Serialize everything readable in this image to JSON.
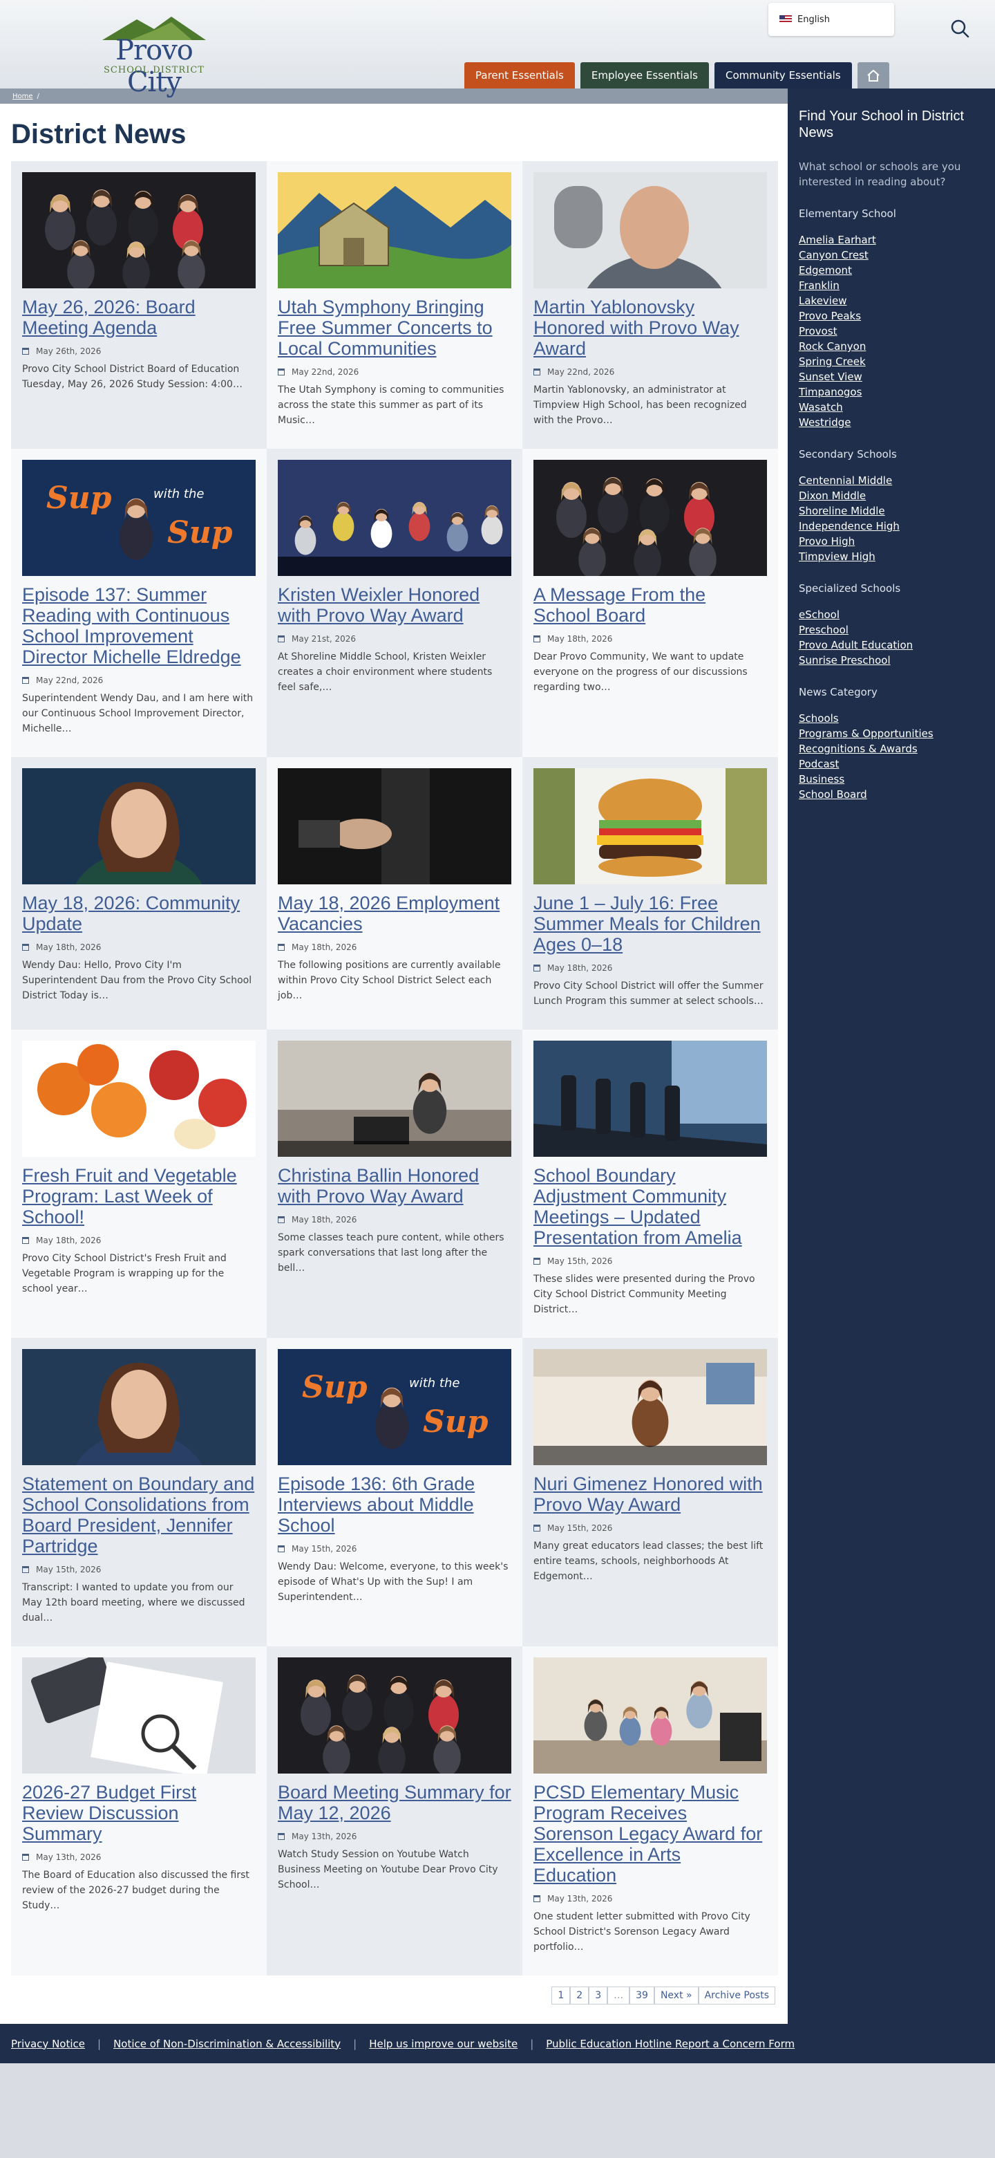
{
  "header": {
    "logo_name": "Provo City",
    "logo_sub": "SCHOOL DISTRICT",
    "language": "English",
    "nav": [
      "Parent Essentials",
      "Employee Essentials",
      "Community Essentials"
    ],
    "colors": {
      "parent": "#c4511d",
      "employee": "#2f4a3a",
      "community": "#1d2b4a",
      "sidebar": "#1f2f4b",
      "link": "#3f5d94"
    }
  },
  "breadcrumb": "Home",
  "page_title": "District News",
  "posts": [
    {
      "title": "May 26, 2026: Board Meeting Agenda",
      "date": "May 26th, 2026",
      "excerpt": "Provo City School District Board of Education Tuesday, May 26, 2026 Study Session: 4:00…",
      "image": "group-photo"
    },
    {
      "title": "Utah Symphony Bringing Free Summer Concerts to Local Communities",
      "date": "May 22nd, 2026",
      "excerpt": "The Utah Symphony is coming to communities across the state this summer as part of its Music…",
      "image": "barn-illustration"
    },
    {
      "title": "Martin Yablonovsky Honored with Provo Way Award",
      "date": "May 22nd, 2026",
      "excerpt": "Martin Yablonovsky, an administrator at Timpview High School, has been recognized with the Provo…",
      "image": "portrait-man"
    },
    {
      "title": "Episode 137: Summer Reading with Continuous School Improvement Director Michelle Eldredge",
      "date": "May 22nd, 2026",
      "excerpt": "Superintendent Wendy Dau, and I am here with our Continuous School Improvement Director, Michelle…",
      "image": "sup-podcast"
    },
    {
      "title": "Kristen Weixler Honored with Provo Way Award",
      "date": "May 21st, 2026",
      "excerpt": "At Shoreline Middle School, Kristen Weixler creates a choir environment where students feel safe,…",
      "image": "choir-classroom"
    },
    {
      "title": "A Message From the School Board",
      "date": "May 18th, 2026",
      "excerpt": "Dear Provo Community, We want to update everyone on the progress of our discussions regarding two…",
      "image": "group-photo"
    },
    {
      "title": "May 18, 2026: Community Update",
      "date": "May 18th, 2026",
      "excerpt": "Wendy Dau: Hello, Provo City I'm Superintendent Dau from the Provo City School District Today is…",
      "image": "portrait-woman"
    },
    {
      "title": "May 18, 2026 Employment Vacancies",
      "date": "May 18th, 2026",
      "excerpt": "The following positions are currently available within Provo City School District Select each job…",
      "image": "handshake"
    },
    {
      "title": "June 1 – July 16: Free Summer Meals for Children Ages 0–18",
      "date": "May 18th, 2026",
      "excerpt": "Provo City School District will offer the Summer Lunch Program this summer at select schools…",
      "image": "burger"
    },
    {
      "title": "Fresh Fruit and Vegetable Program: Last Week of School!",
      "date": "May 18th, 2026",
      "excerpt": "Provo City School District's Fresh Fruit and Vegetable Program is wrapping up for the school year…",
      "image": "fruit"
    },
    {
      "title": "Christina Ballin Honored with Provo Way Award",
      "date": "May 18th, 2026",
      "excerpt": "Some classes teach pure content, while others spark conversations that last long after the bell…",
      "image": "teacher-classroom"
    },
    {
      "title": "School Boundary Adjustment Community Meetings – Updated Presentation from Amelia",
      "date": "May 15th, 2026",
      "excerpt": "These slides were presented during the Provo City School District Community Meeting District…",
      "image": "boardroom"
    },
    {
      "title": "Statement on Boundary and School Consolidations from Board President, Jennifer Partridge",
      "date": "May 15th, 2026",
      "excerpt": "Transcript:  I wanted to update you from our May 12th board meeting, where we discussed dual…",
      "image": "portrait-woman-2"
    },
    {
      "title": "Episode 136: 6th Grade Interviews about Middle School",
      "date": "May 15th, 2026",
      "excerpt": "Wendy Dau: Welcome, everyone, to this week's episode of What's Up with the Sup! I am Superintendent…",
      "image": "sup-podcast"
    },
    {
      "title": "Nuri Gimenez Honored with Provo Way Award",
      "date": "May 15th, 2026",
      "excerpt": "Many great educators lead classes; the best lift entire teams, schools, neighborhoods At Edgemont…",
      "image": "teacher-woman"
    },
    {
      "title": "2026-27 Budget First Review Discussion Summary",
      "date": "May 13th, 2026",
      "excerpt": "The Board of Education also discussed the first review of the 2026-27 budget during the Study…",
      "image": "budget-papers"
    },
    {
      "title": "Board Meeting Summary for May 12, 2026",
      "date": "May 13th, 2026",
      "excerpt": "Watch Study Session on Youtube Watch Business Meeting on Youtube Dear Provo City School…",
      "image": "group-photo"
    },
    {
      "title": "PCSD Elementary Music Program Receives Sorenson Legacy Award for Excellence in Arts Education",
      "date": "May 13th, 2026",
      "excerpt": "One student letter submitted with Provo City School District's Sorenson Legacy Award portfolio…",
      "image": "music-classroom"
    }
  ],
  "pagination": [
    "1",
    "2",
    "3",
    "…",
    "39",
    "Next »",
    "Archive Posts"
  ],
  "sidebar": {
    "title": "Find Your School in District News",
    "subtitle": "What school or schools are you interested in reading about?",
    "groups": [
      {
        "heading": "Elementary School",
        "items": [
          "Amelia Earhart",
          "Canyon Crest",
          "Edgemont",
          "Franklin",
          "Lakeview",
          "Provo Peaks",
          "Provost",
          "Rock Canyon",
          "Spring Creek",
          "Sunset View",
          "Timpanogos",
          "Wasatch",
          "Westridge"
        ]
      },
      {
        "heading": "Secondary Schools",
        "items": [
          "Centennial Middle",
          "Dixon Middle",
          "Shoreline Middle",
          "Independence High",
          "Provo High",
          "Timpview High"
        ]
      },
      {
        "heading": "Specialized Schools",
        "items": [
          "eSchool",
          "Preschool",
          "Provo Adult Education",
          "Sunrise Preschool"
        ]
      },
      {
        "heading": "News Category",
        "items": [
          "Schools",
          "Programs & Opportunities",
          "Recognitions & Awards",
          "Podcast",
          "Business",
          "School Board"
        ]
      }
    ]
  },
  "footer": [
    "Privacy Notice",
    "Notice of Non-Discrimination & Accessibility",
    "Help us improve our website",
    "Public Education Hotline Report a Concern Form"
  ]
}
